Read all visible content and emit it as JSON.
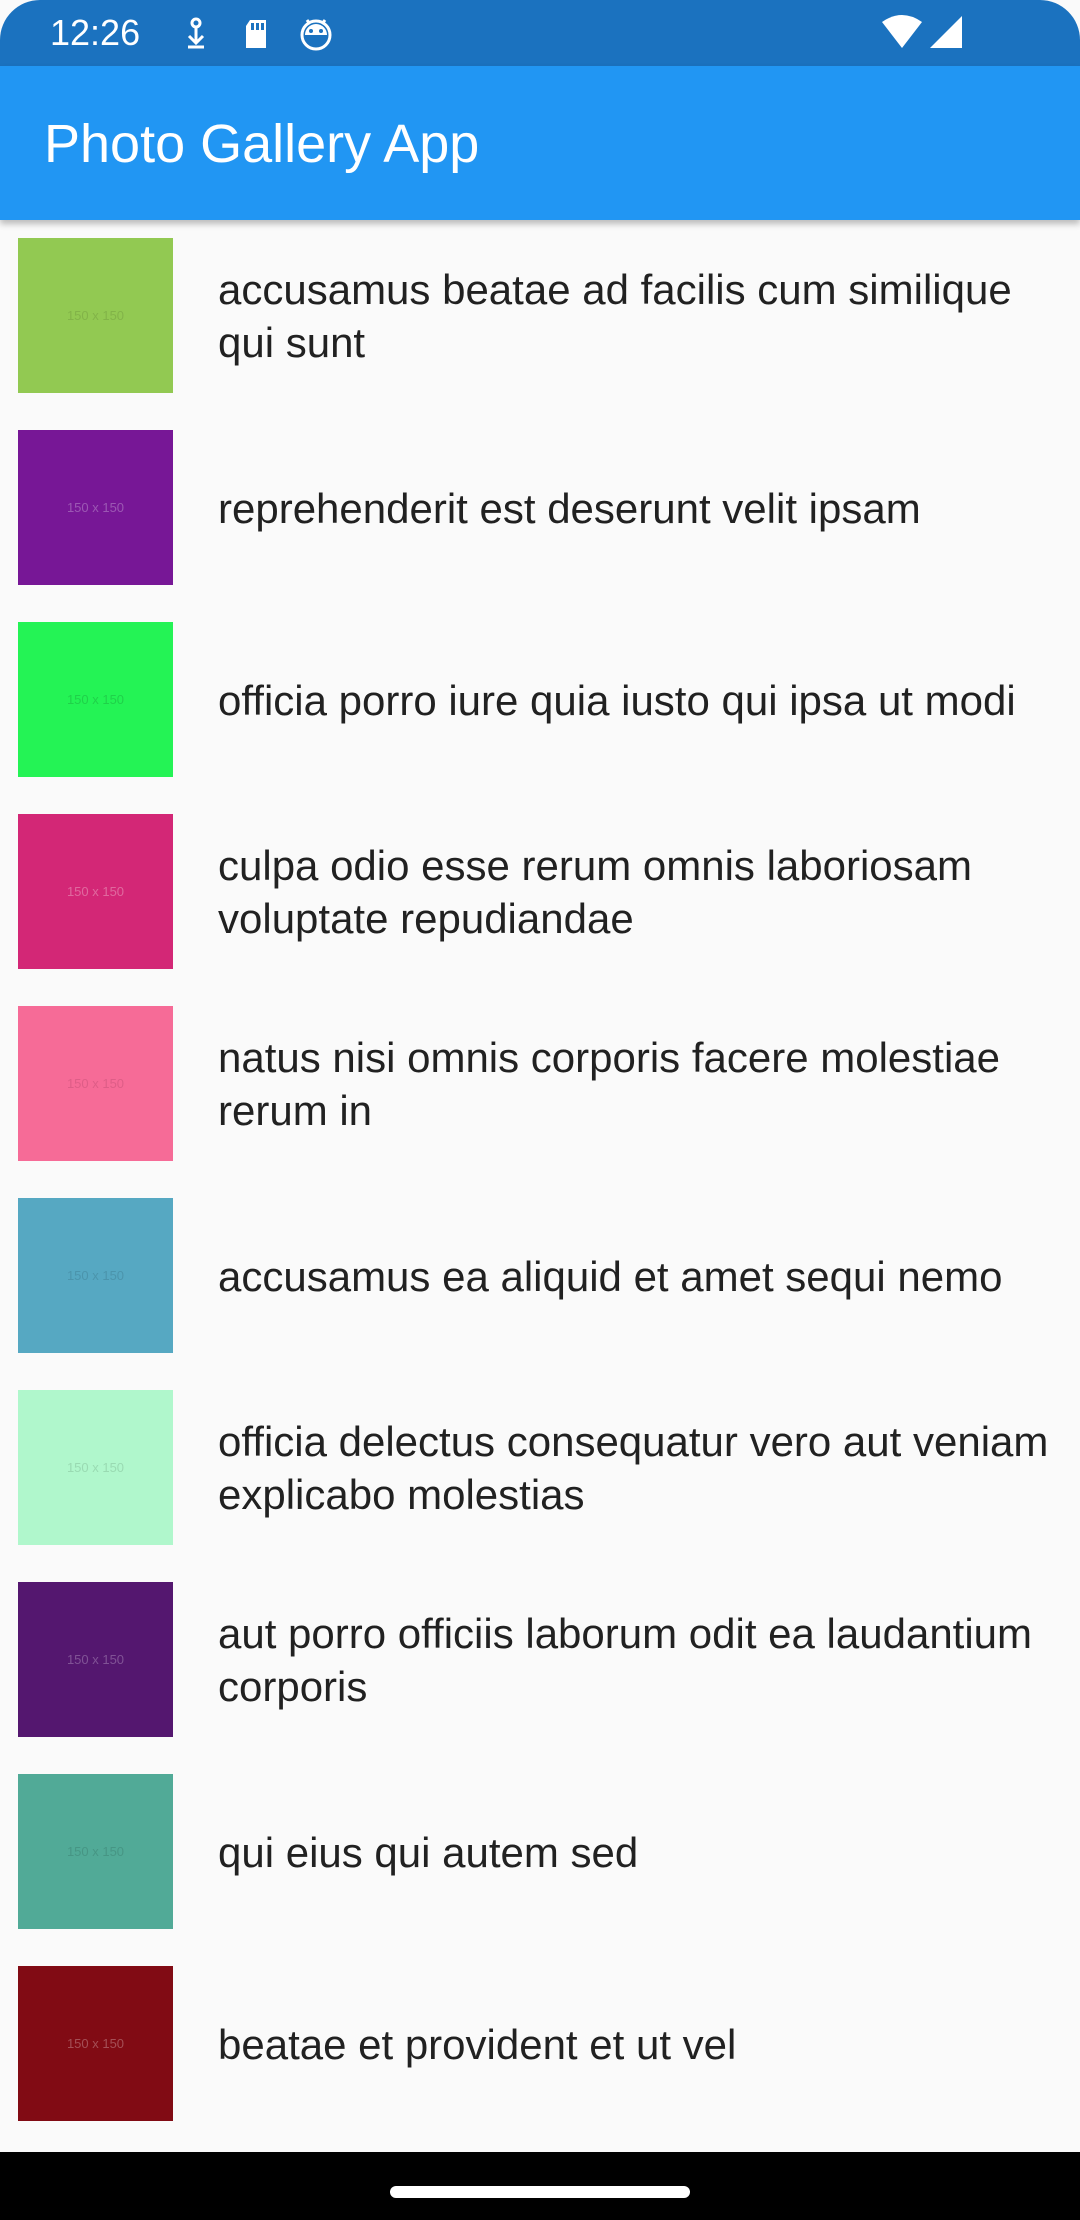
{
  "status_bar": {
    "time": "12:26",
    "left_icons": [
      "download-icon",
      "sd-card-icon",
      "android-debug-icon"
    ],
    "right_icons": [
      "wifi-icon",
      "cell-signal-icon"
    ],
    "color": "#1b72bf"
  },
  "app_bar": {
    "title": "Photo Gallery App",
    "color": "#2196f3"
  },
  "photos": [
    {
      "title": "accusamus beatae ad facilis cum similique qui sunt",
      "thumb_label": "150 x 150",
      "thumb_color": "#92c952",
      "label_color": "#6f9a3e"
    },
    {
      "title": "reprehenderit est deserunt velit ipsam",
      "thumb_label": "150 x 150",
      "thumb_color": "#771796",
      "label_color": "#c8a5d6"
    },
    {
      "title": "officia porro iure quia iusto qui ipsa ut modi",
      "thumb_label": "150 x 150",
      "thumb_color": "#24f355",
      "label_color": "#1aa83c"
    },
    {
      "title": "culpa odio esse rerum omnis laboriosam voluptate repudiandae",
      "thumb_label": "150 x 150",
      "thumb_color": "#d32776",
      "label_color": "#f0b8d0"
    },
    {
      "title": "natus nisi omnis corporis facere molestiae rerum in",
      "thumb_label": "150 x 150",
      "thumb_color": "#f66b97",
      "label_color": "#c24e74"
    },
    {
      "title": "accusamus ea aliquid et amet sequi nemo",
      "thumb_label": "150 x 150",
      "thumb_color": "#56a8c2",
      "label_color": "#3e7d92"
    },
    {
      "title": "officia delectus consequatur vero aut veniam explicabo molestias",
      "thumb_label": "150 x 150",
      "thumb_color": "#b0f7cc",
      "label_color": "#7fb894"
    },
    {
      "title": "aut porro officiis laborum odit ea laudantium corporis",
      "thumb_label": "150 x 150",
      "thumb_color": "#54176f",
      "label_color": "#b69ac4"
    },
    {
      "title": "qui eius qui autem sed",
      "thumb_label": "150 x 150",
      "thumb_color": "#51aa97",
      "label_color": "#3a7d6e"
    },
    {
      "title": "beatae et provident et ut vel",
      "thumb_label": "150 x 150",
      "thumb_color": "#810b14",
      "label_color": "#d0a0a4"
    }
  ]
}
